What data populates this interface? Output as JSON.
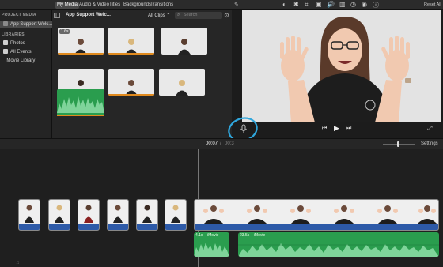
{
  "top_tabs": [
    "My Media",
    "Audio & Video",
    "Titles",
    "Backgrounds",
    "Transitions"
  ],
  "sidebar": {
    "project_header": "PROJECT MEDIA",
    "project_item": "App Support Welc...",
    "libraries_header": "LIBRARIES",
    "items": [
      "Photos",
      "All Events",
      "iMovie Library"
    ]
  },
  "browser": {
    "filter": "All Clips",
    "search_placeholder": "Search",
    "first_clip_duration": "1.6s"
  },
  "viewer": {
    "reset_label": "Reset All",
    "timecode_current": "00:07",
    "timecode_sep": "/",
    "timecode_total": "00:3"
  },
  "timeline": {
    "settings_label": "Settings",
    "audio_clip_1": "4.1s – iMovie",
    "audio_clip_2": "23.5s – iMovie"
  },
  "colors": {
    "accent_orange": "#e08a1e",
    "clip_blue": "#2d5aa8",
    "audio_green": "#2a9d4e",
    "annotation_blue": "#2fa6dc"
  }
}
